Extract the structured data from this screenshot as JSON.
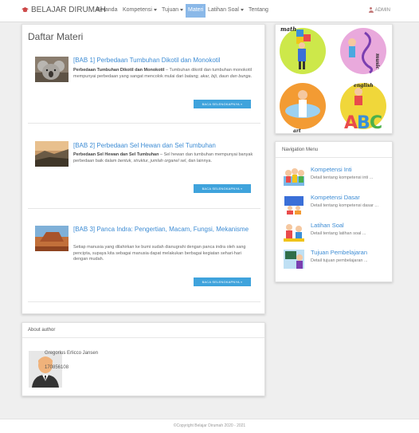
{
  "brand": {
    "name": "BELAJAR DIRUMAH",
    "icon": "graduation-cap-icon",
    "color": "#c44"
  },
  "nav": {
    "items": [
      {
        "label": "Beranda"
      },
      {
        "label": "Kompetensi"
      },
      {
        "label": "Tujuan"
      },
      {
        "label": "Materi"
      },
      {
        "label": "Latihan Soal"
      },
      {
        "label": "Tentang"
      }
    ],
    "active": "Materi",
    "user": "ADMIN"
  },
  "main": {
    "title": "Daftar Materi",
    "entries": [
      {
        "title": "[BAB 1] Perbedaan Tumbuhan Dikotil dan Monokotil",
        "lead": "Perbedaan Tumbuhan Dikotil dan Monokotil",
        "text": " – Tumbuhan dikotil dan tumbuhan monokotil mempunyai perbedaan yang sangat mencolok mulai dari ",
        "em": "batang, akar, biji, daun dan bunga",
        "tail": ".",
        "button": "BACA SELENGKAPNYA »"
      },
      {
        "title": "[BAB 2] Perbedaan Sel Hewan dan Sel Tumbuhan",
        "lead": "Perbedaan Sel Hewan dan Sel Tumbuhan",
        "text": " – Sel hewan dan tumbuhan mempunyai banyak perbedaan baik dalam ",
        "em": "bentuk, struktur, jumlah organel sel",
        "tail": ", dan lainnya.",
        "button": "BACA SELENGKAPNYA »"
      },
      {
        "title": "[BAB 3] Panca Indra: Pengertian, Macam, Fungsi, Mekanisme",
        "lead": "",
        "text": "Setiap manusia yang dilahirkan ke bumi sudah dianugrahi dengan panca indra oleh sang pencipta, supaya kita sebagai manusia dapat melakukan berbagai kegiatan sehari-hari dengan mudah.",
        "em": "",
        "tail": "",
        "button": "BACA SELENGKAPNYA »"
      }
    ]
  },
  "author": {
    "heading": "About author",
    "name": "Gregorius Erlicco Jansen",
    "id": "170856108"
  },
  "sidebar": {
    "illustration_words": [
      "math",
      "music",
      "art",
      "english",
      "ABC"
    ],
    "nav_heading": "Navigation Menu",
    "links": [
      {
        "title": "Kompetensi Inti",
        "desc": "Detail tentang kompetensi inti ..."
      },
      {
        "title": "Kompetensi Dasar",
        "desc": "Detail tentang kompetensi dasar ..."
      },
      {
        "title": "Latihan Soal",
        "desc": "Detail tentang latihan soal ..."
      },
      {
        "title": "Tujuan Pembelajaran",
        "desc": "Detail tujuan pembelajaran ..."
      }
    ]
  },
  "footer": {
    "text": "©Copyright Belajar Dirumah 2020 - 2021"
  },
  "colors": {
    "accent": "#3d8cd4",
    "button": "#3fa3dc",
    "nav_active": "#8ab8e8"
  }
}
